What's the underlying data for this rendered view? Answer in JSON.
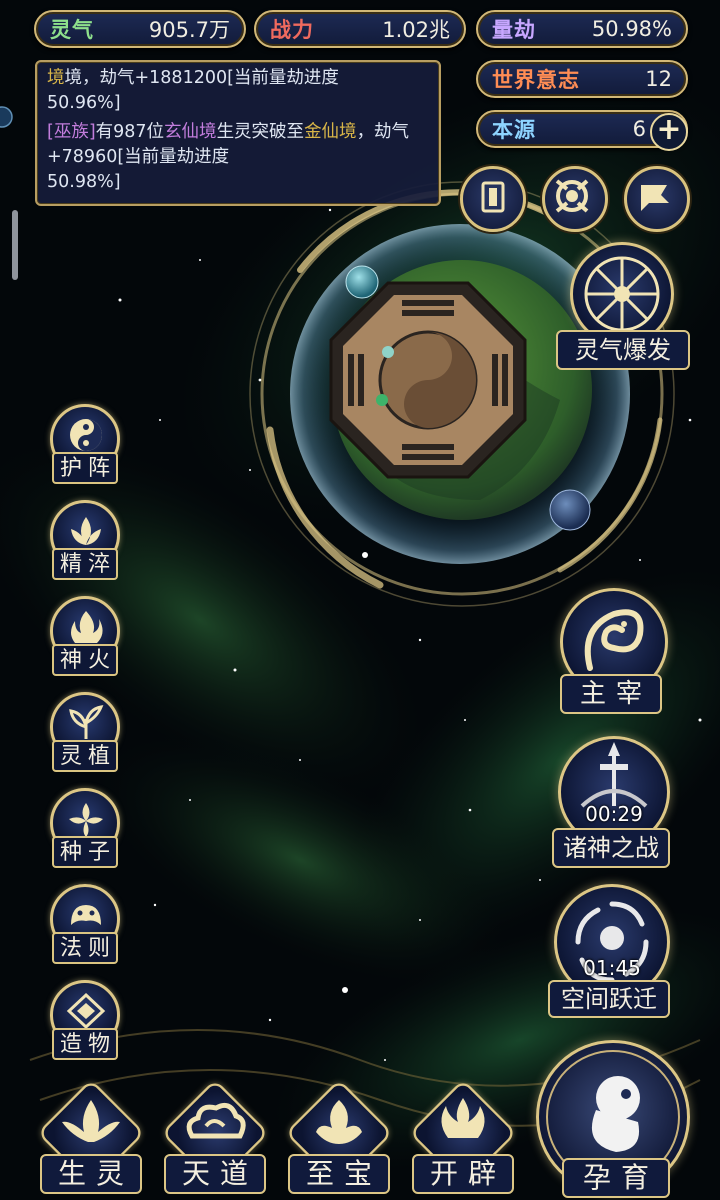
{
  "stats": {
    "lingqi": {
      "label": "灵气",
      "value": "905.7万",
      "label_color": "#8ee08c"
    },
    "zhanli": {
      "label": "战力",
      "value": "1.02兆",
      "label_color": "#ef6a5e"
    },
    "liangjie": {
      "label": "量劫",
      "value": "50.98%",
      "label_color": "#c7a7ff"
    },
    "shijie": {
      "label": "世界意志",
      "value": "12",
      "label_color": "#ff8d54"
    },
    "benyuan": {
      "label": "本源",
      "value": "6",
      "label_color": "#8ed4ff"
    }
  },
  "log": {
    "entry1": {
      "part1": "境，劫气+1881200[当前量劫进度",
      "part2": "50.96%]"
    },
    "entry2": {
      "tag": "[巫族]",
      "a": "有987位",
      "realm_from": "玄仙境",
      "b": "生灵突破至",
      "realm_to": "金仙境",
      "c": "，劫气+78960[当前量劫进度",
      "d": "50.98%]"
    }
  },
  "actions": {
    "burst_label": "灵气爆发",
    "lord_label": "主宰",
    "war_label": "诸神之战",
    "war_timer": "00:29",
    "jump_label": "空间跃迁",
    "jump_timer": "01:45",
    "nurture_label": "孕育"
  },
  "side_menu": [
    {
      "label": "护阵",
      "icon": "yin-yang-icon"
    },
    {
      "label": "精淬",
      "icon": "lotus-icon"
    },
    {
      "label": "神火",
      "icon": "flame-icon"
    },
    {
      "label": "灵植",
      "icon": "plant-icon"
    },
    {
      "label": "种子",
      "icon": "seed-icon"
    },
    {
      "label": "法则",
      "icon": "beast-icon"
    },
    {
      "label": "造物",
      "icon": "rune-icon"
    }
  ],
  "bottom_menu": [
    {
      "label": "生灵",
      "icon": "phoenix-icon"
    },
    {
      "label": "天道",
      "icon": "cloud-icon"
    },
    {
      "label": "至宝",
      "icon": "treasure-icon"
    },
    {
      "label": "开辟",
      "icon": "axe-flame-icon"
    }
  ],
  "colors": {
    "gold_border": "#dcc685",
    "panel_bg": "#101a3c",
    "realm_purple": "#c27ddc",
    "realm_gold": "#d8b548"
  }
}
